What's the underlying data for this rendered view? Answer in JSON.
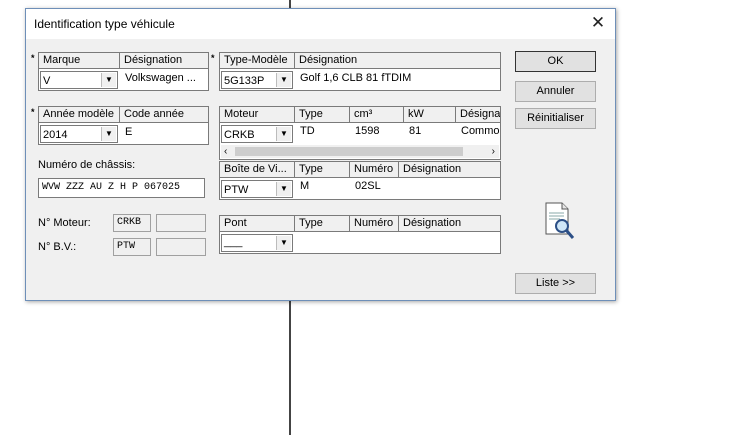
{
  "dialog": {
    "title": "Identification type véhicule",
    "close_glyph": "✕"
  },
  "marque": {
    "required_mark": "*",
    "col_marque": "Marque",
    "col_designation": "Désignation",
    "value": "V",
    "designation": "Volkswagen ..."
  },
  "type_modele": {
    "required_mark": "*",
    "col_type": "Type-Modèle",
    "col_designation": "Désignation",
    "value": "5G133P",
    "designation": "Golf 1,6 CLB 81 fTDIM"
  },
  "annee": {
    "required_mark": "*",
    "col_annee": "Année modèle",
    "col_code": "Code année",
    "value": "2014",
    "code": "E"
  },
  "moteur": {
    "headers": [
      "Moteur",
      "Type",
      "cm³",
      "kW",
      "Désigna"
    ],
    "value": "CRKB",
    "type": "TD",
    "cm3": "1598",
    "kw": "81",
    "designation": "Common"
  },
  "chassis": {
    "label": "Numéro de châssis:",
    "value": "WVW ZZZ AU Z H P 067025"
  },
  "boite": {
    "headers": [
      "Boîte de Vi...",
      "Type",
      "Numéro",
      "Désignation"
    ],
    "value": "PTW",
    "type": "M",
    "numero": "02SL",
    "designation": ""
  },
  "pont": {
    "headers": [
      "Pont",
      "Type",
      "Numéro",
      "Désignation"
    ],
    "value": "___"
  },
  "n_moteur": {
    "label": "N° Moteur:",
    "code": "CRKB",
    "extra": ""
  },
  "n_bv": {
    "label": "N° B.V.:",
    "code": "PTW",
    "extra": ""
  },
  "buttons": {
    "ok": "OK",
    "annuler": "Annuler",
    "reinitialiser": "Réinitialiser",
    "liste": "Liste >>"
  },
  "icons": {
    "dropdown": "chevron-down-icon",
    "search_doc": "document-search-icon"
  },
  "colors": {
    "dialog_border": "#6e8fb8",
    "face": "#f0f0f0"
  }
}
